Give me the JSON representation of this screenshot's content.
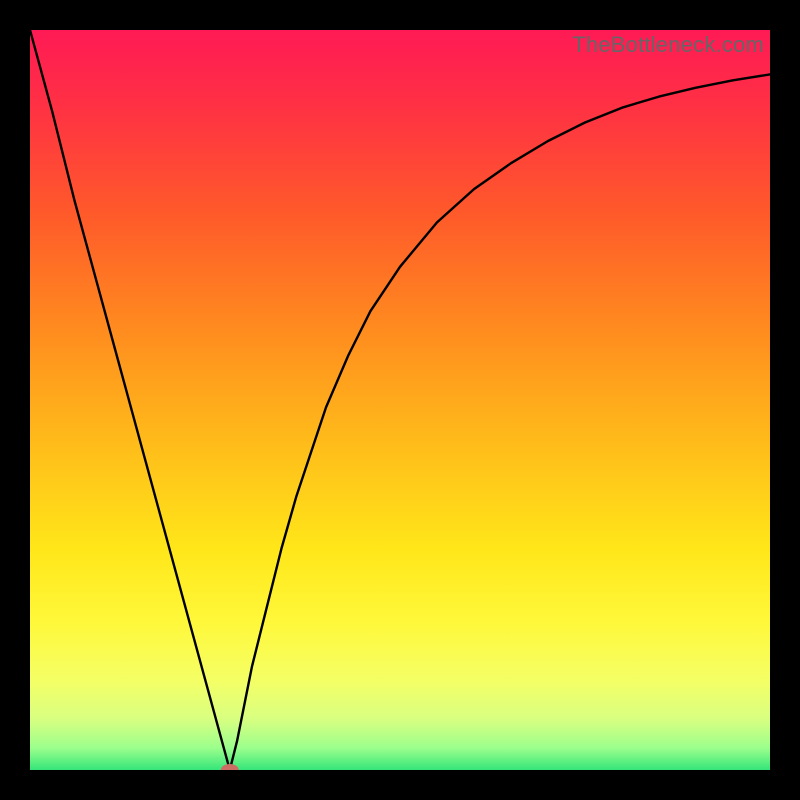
{
  "watermark": "TheBottleneck.com",
  "chart_data": {
    "type": "line",
    "title": "",
    "xlabel": "",
    "ylabel": "",
    "xlim": [
      0,
      100
    ],
    "ylim": [
      0,
      100
    ],
    "gradient_stops": [
      {
        "offset": 0.0,
        "color": "#ff1a55"
      },
      {
        "offset": 0.1,
        "color": "#ff3044"
      },
      {
        "offset": 0.25,
        "color": "#ff5a2a"
      },
      {
        "offset": 0.4,
        "color": "#ff8a1f"
      },
      {
        "offset": 0.55,
        "color": "#ffb91a"
      },
      {
        "offset": 0.7,
        "color": "#ffe619"
      },
      {
        "offset": 0.8,
        "color": "#fff83a"
      },
      {
        "offset": 0.88,
        "color": "#f4ff66"
      },
      {
        "offset": 0.93,
        "color": "#d9ff80"
      },
      {
        "offset": 0.97,
        "color": "#9cff8c"
      },
      {
        "offset": 1.0,
        "color": "#35e57a"
      }
    ],
    "marker": {
      "x": 27,
      "y": 0,
      "color": "#cc6e63",
      "rx": 9,
      "ry": 6
    },
    "series": [
      {
        "name": "curve",
        "points": [
          {
            "x": 0,
            "y": 100
          },
          {
            "x": 3,
            "y": 89
          },
          {
            "x": 6,
            "y": 77
          },
          {
            "x": 9,
            "y": 66
          },
          {
            "x": 12,
            "y": 55
          },
          {
            "x": 15,
            "y": 44
          },
          {
            "x": 18,
            "y": 33
          },
          {
            "x": 21,
            "y": 22
          },
          {
            "x": 24,
            "y": 11
          },
          {
            "x": 27,
            "y": 0
          },
          {
            "x": 28,
            "y": 4
          },
          {
            "x": 29,
            "y": 9
          },
          {
            "x": 30,
            "y": 14
          },
          {
            "x": 32,
            "y": 22
          },
          {
            "x": 34,
            "y": 30
          },
          {
            "x": 36,
            "y": 37
          },
          {
            "x": 38,
            "y": 43
          },
          {
            "x": 40,
            "y": 49
          },
          {
            "x": 43,
            "y": 56
          },
          {
            "x": 46,
            "y": 62
          },
          {
            "x": 50,
            "y": 68
          },
          {
            "x": 55,
            "y": 74
          },
          {
            "x": 60,
            "y": 78.5
          },
          {
            "x": 65,
            "y": 82
          },
          {
            "x": 70,
            "y": 85
          },
          {
            "x": 75,
            "y": 87.5
          },
          {
            "x": 80,
            "y": 89.5
          },
          {
            "x": 85,
            "y": 91
          },
          {
            "x": 90,
            "y": 92.2
          },
          {
            "x": 95,
            "y": 93.2
          },
          {
            "x": 100,
            "y": 94
          }
        ]
      }
    ]
  }
}
